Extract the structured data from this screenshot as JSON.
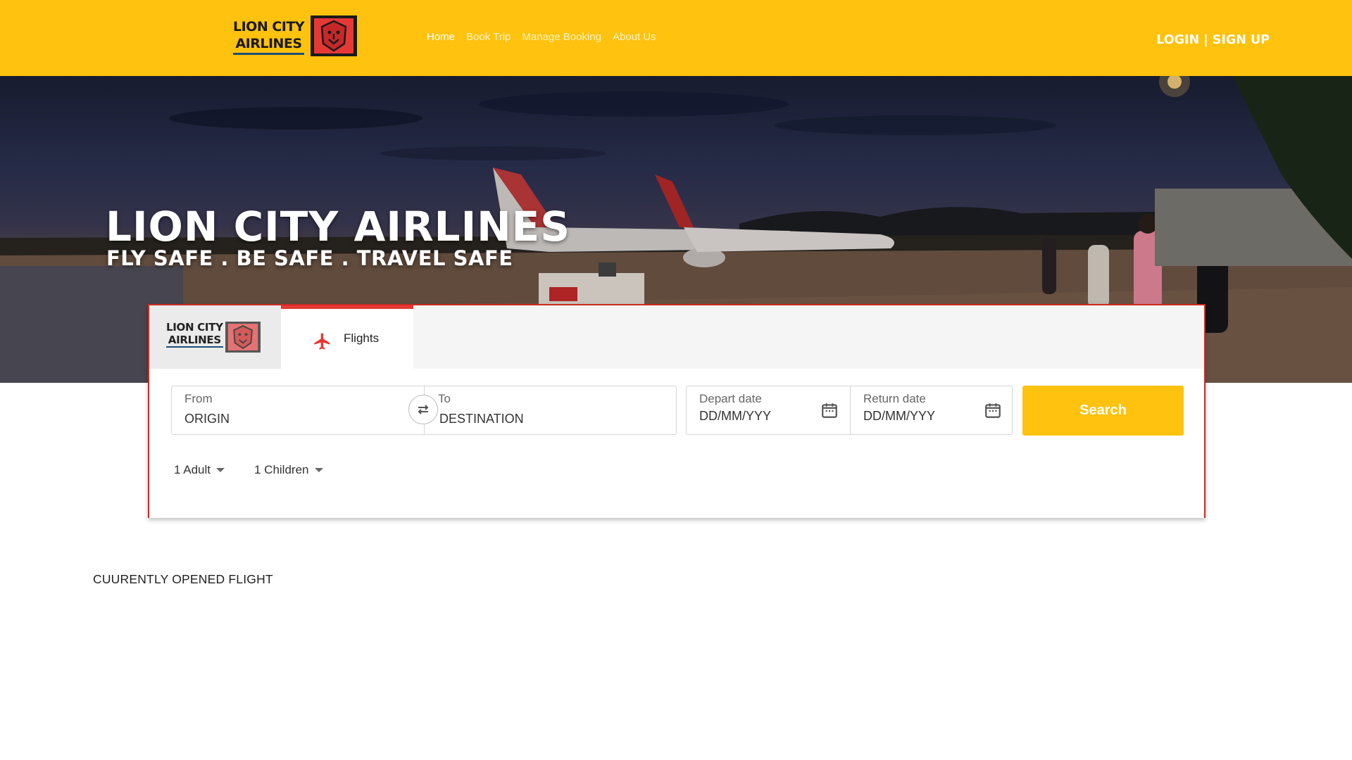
{
  "brand": {
    "line1": "LION CITY",
    "line2": "AIRLINES",
    "primary_color": "#FFC20E",
    "accent_red": "#E53935"
  },
  "nav": {
    "items": [
      "Home",
      "Book Trip",
      "Manage Booking",
      "About Us"
    ],
    "active": "Home"
  },
  "auth": {
    "login": "LOGIN",
    "separator": " | ",
    "signup": "SIGN UP"
  },
  "hero": {
    "title": "LION CITY AIRLINES",
    "subtitle": "FLY SAFE . BE SAFE . TRAVEL SAFE"
  },
  "booking": {
    "tab_flights": "Flights",
    "from_label": "From",
    "from_placeholder": "ORIGIN",
    "to_label": "To",
    "to_placeholder": "DESTINATION",
    "depart_label": "Depart date",
    "depart_placeholder": "DD/MM/YYY",
    "return_label": "Return date",
    "return_placeholder": "DD/MM/YYY",
    "search_label": "Search",
    "adults": "1 Adult",
    "children": "1 Children"
  },
  "section": {
    "opened_flight": "CUURENTLY OPENED FLIGHT"
  },
  "icons": [
    "lion-logo-icon",
    "plane-icon",
    "swap-icon",
    "calendar-icon",
    "caret-down-icon"
  ]
}
